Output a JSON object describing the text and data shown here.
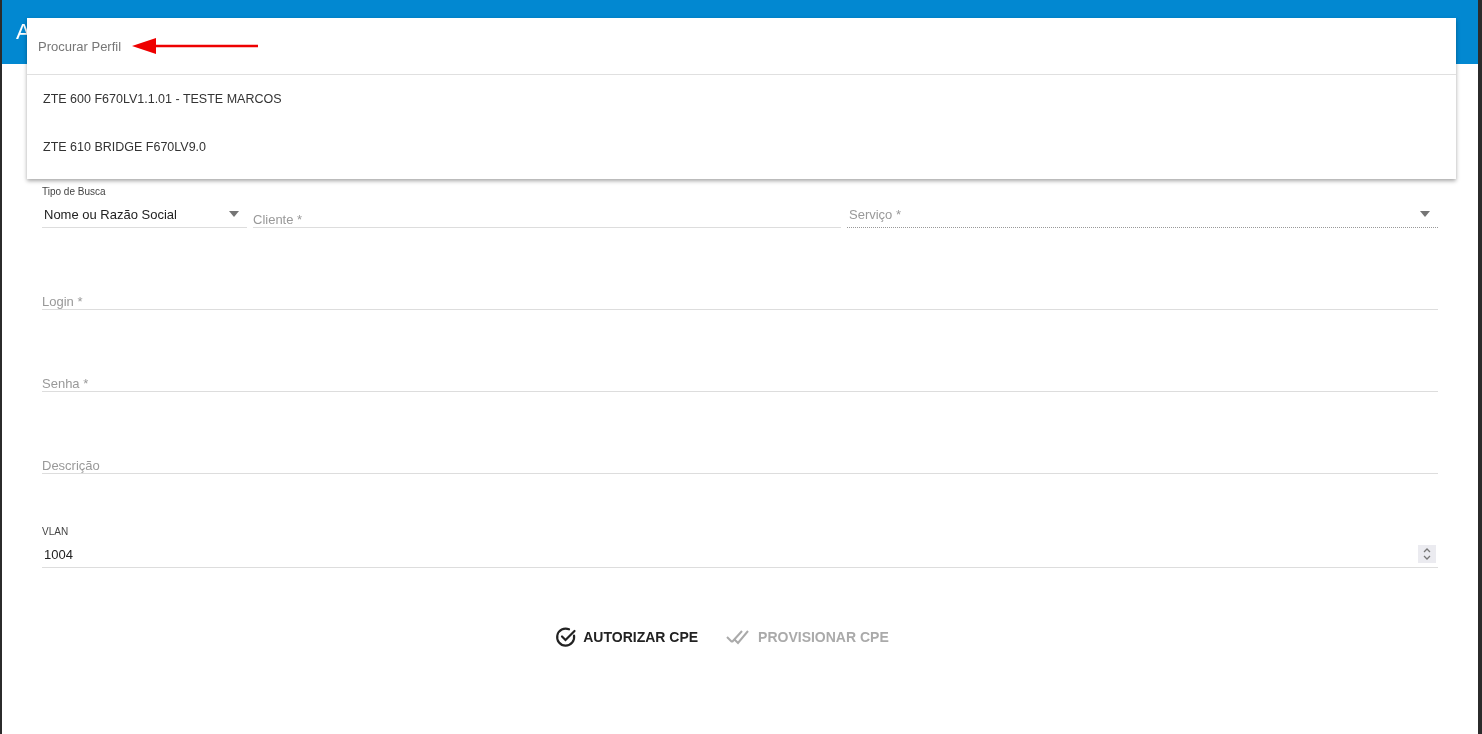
{
  "dialog": {
    "title": "A"
  },
  "profile_dropdown": {
    "placeholder": "Procurar Perfil",
    "options": [
      {
        "label": "ZTE 600 F670LV1.1.01 - TESTE MARCOS",
        "selected": false
      },
      {
        "label": "ZTE 610 BRIDGE F670LV9.0",
        "selected": false
      }
    ]
  },
  "search_row": [
    {
      "kind": "select",
      "label": "Tipo de Busca",
      "value": "Nome ou Razão Social",
      "disabled": false
    },
    {
      "kind": "input",
      "placeholder": "Cliente *",
      "disabled": false
    },
    {
      "kind": "select",
      "placeholder": "Serviço *",
      "disabled": true
    }
  ],
  "fields": [
    {
      "kind": "input",
      "placeholder": "Login *"
    },
    {
      "kind": "input",
      "placeholder": "Senha *"
    },
    {
      "kind": "input",
      "placeholder": "Descrição"
    },
    {
      "kind": "number",
      "label": "VLAN",
      "value": "1004"
    }
  ],
  "actions": [
    {
      "kind": "authorize",
      "label": "AUTORIZAR CPE",
      "disabled": false
    },
    {
      "kind": "provision",
      "label": "PROVISIONAR CPE",
      "disabled": true
    }
  ]
}
